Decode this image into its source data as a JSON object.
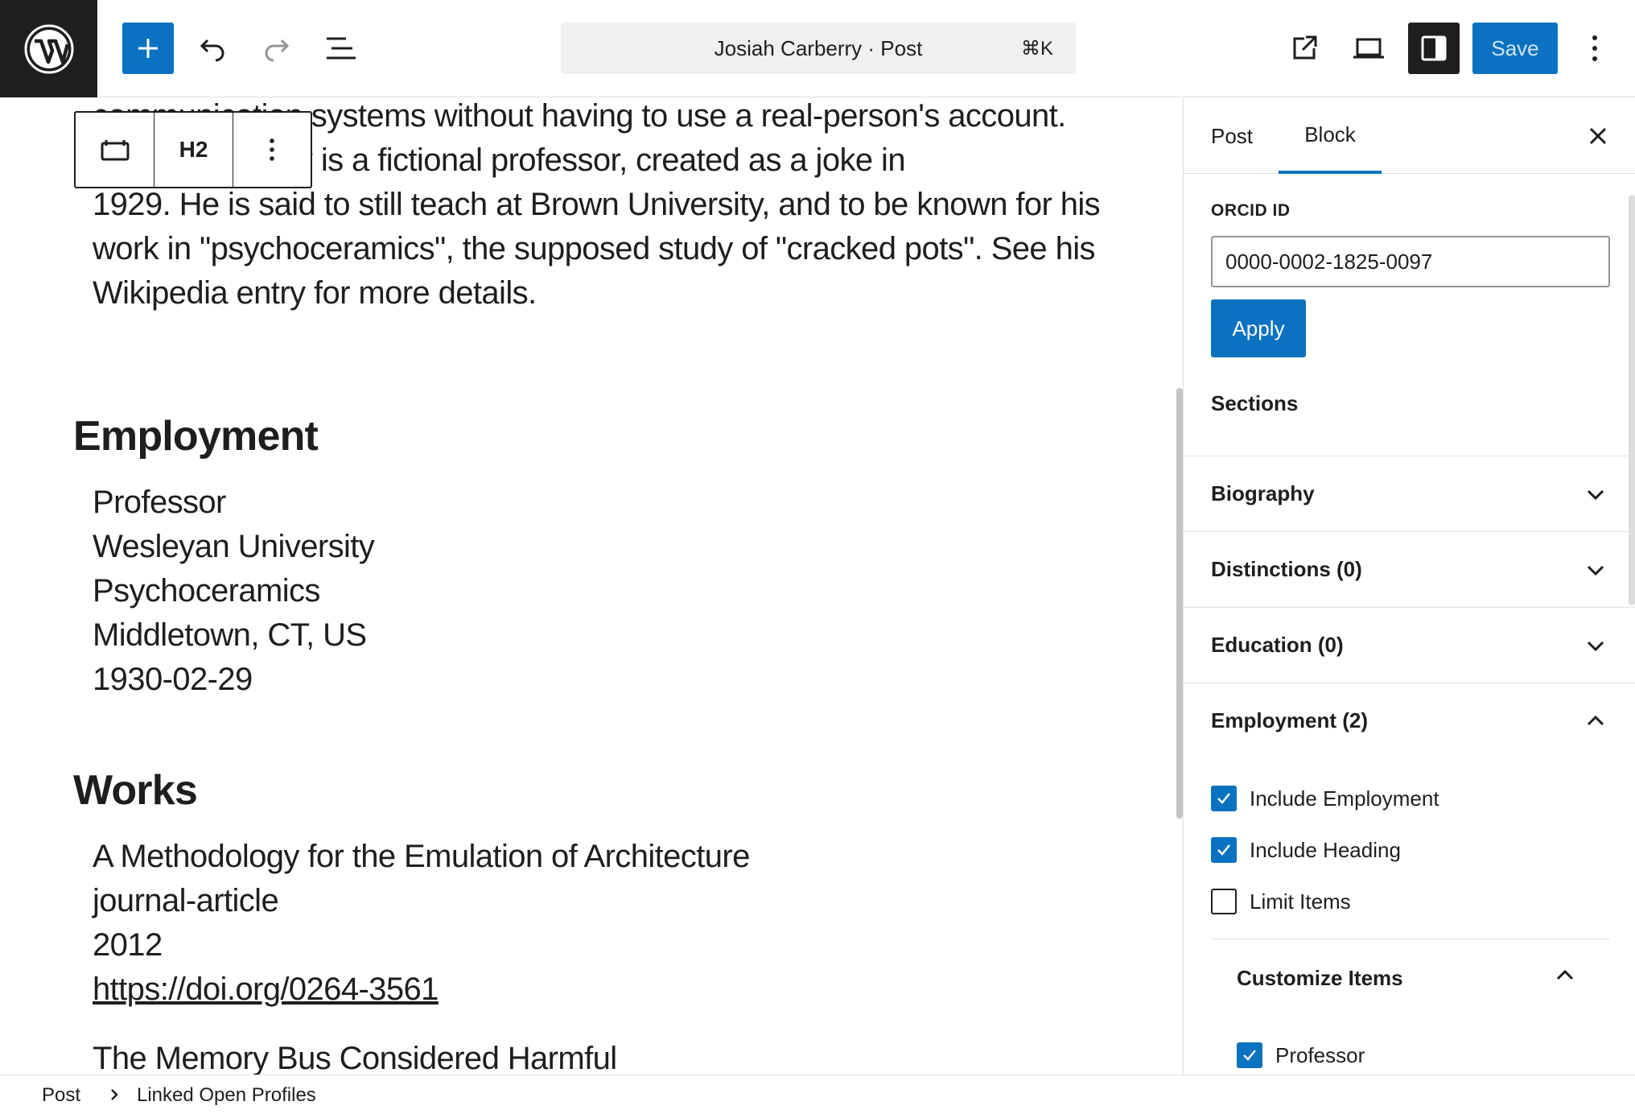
{
  "header": {
    "command_title": "Josiah Carberry · Post",
    "command_shortcut": "⌘K",
    "save_label": "Save"
  },
  "editor": {
    "intro_lines": [
      "communication systems without having to use a real-person's account.",
      "Josiah Carberry is a fictional professor, created as a joke in",
      "1929. He is said to still teach at Brown University, and to be known for his",
      "work in \"psychoceramics\", the supposed study of \"cracked pots\". See his",
      "Wikipedia entry for more details."
    ],
    "block_toolbar": {
      "heading_level": "H2"
    },
    "employment": {
      "heading": "Employment",
      "role": "Professor",
      "organization": "Wesleyan University",
      "department": "Psychoceramics",
      "location": "Middletown, CT, US",
      "date": "1930-02-29"
    },
    "works": {
      "heading": "Works",
      "items": [
        {
          "title": "A Methodology for the Emulation of Architecture",
          "type": "journal-article",
          "year": "2012",
          "doi": "https://doi.org/0264-3561"
        },
        {
          "title": "The Memory Bus Considered Harmful"
        }
      ]
    }
  },
  "sidebar": {
    "tabs": [
      "Post",
      "Block"
    ],
    "active_tab": "Block",
    "orcid_label": "ORCID ID",
    "orcid_value": "0000-0002-1825-0097",
    "apply_label": "Apply",
    "sections_label": "Sections",
    "panels": [
      {
        "title": "Biography",
        "expanded": false
      },
      {
        "title": "Distinctions (0)",
        "expanded": false
      },
      {
        "title": "Education (0)",
        "expanded": false
      },
      {
        "title": "Employment (2)",
        "expanded": true
      }
    ],
    "employment_options": [
      {
        "label": "Include Employment",
        "checked": true
      },
      {
        "label": "Include Heading",
        "checked": true
      },
      {
        "label": "Limit Items",
        "checked": false
      }
    ],
    "customize_items_label": "Customize Items",
    "customize_items": [
      {
        "label": "Professor",
        "checked": true
      }
    ]
  },
  "footer": {
    "breadcrumb": [
      "Post",
      "Linked Open Profiles"
    ]
  },
  "colors": {
    "accent": "#0a72c0",
    "dark": "#1e1e1e",
    "border": "#e0e0e0",
    "command_bg": "#f0f0f0"
  },
  "icons": {
    "logo": "wordpress-logo-icon",
    "inserter": "plus-icon",
    "undo": "undo-icon",
    "redo": "redo-icon",
    "list_view": "list-view-icon",
    "view": "external-link-icon",
    "preview": "laptop-icon",
    "settings": "sidebar-icon",
    "options": "more-vertical-icon"
  }
}
